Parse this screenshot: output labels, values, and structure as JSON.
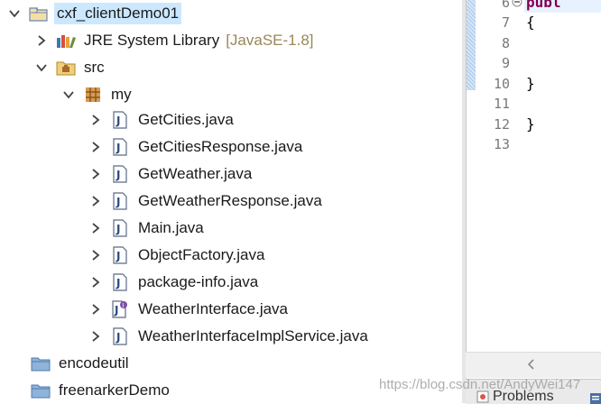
{
  "tree": {
    "items": [
      {
        "label": "cxf_clientDemo01",
        "icon": "java-project-icon",
        "expanded": true,
        "selected": true
      },
      {
        "label": "JRE System Library",
        "decoration": "[JavaSE-1.8]",
        "icon": "library-icon",
        "expanded": false
      },
      {
        "label": "src",
        "icon": "source-folder-icon",
        "expanded": true
      },
      {
        "label": "my",
        "icon": "package-icon",
        "expanded": true
      },
      {
        "label": "GetCities.java",
        "icon": "java-file-icon"
      },
      {
        "label": "GetCitiesResponse.java",
        "icon": "java-file-icon"
      },
      {
        "label": "GetWeather.java",
        "icon": "java-file-icon"
      },
      {
        "label": "GetWeatherResponse.java",
        "icon": "java-file-icon"
      },
      {
        "label": "Main.java",
        "icon": "java-file-icon"
      },
      {
        "label": "ObjectFactory.java",
        "icon": "java-file-icon"
      },
      {
        "label": "package-info.java",
        "icon": "java-file-icon"
      },
      {
        "label": "WeatherInterface.java",
        "icon": "java-interface-file-icon"
      },
      {
        "label": "WeatherInterfaceImplService.java",
        "icon": "java-file-icon"
      },
      {
        "label": "encodeutil",
        "icon": "closed-project-icon"
      },
      {
        "label": "freenarkerDemo",
        "icon": "closed-project-icon"
      }
    ]
  },
  "editor": {
    "lines": [
      {
        "number": "6",
        "code": "publ",
        "style": "kw"
      },
      {
        "number": "7",
        "code": "{"
      },
      {
        "number": "8",
        "code": ""
      },
      {
        "number": "9",
        "code": ""
      },
      {
        "number": "10",
        "code": "}"
      },
      {
        "number": "11",
        "code": ""
      },
      {
        "number": "12",
        "code": "}"
      },
      {
        "number": "13",
        "code": ""
      }
    ]
  },
  "bottom_panel": {
    "problems_tab_label": "Problems"
  },
  "watermark": "https://blog.csdn.net/AndyWei147"
}
